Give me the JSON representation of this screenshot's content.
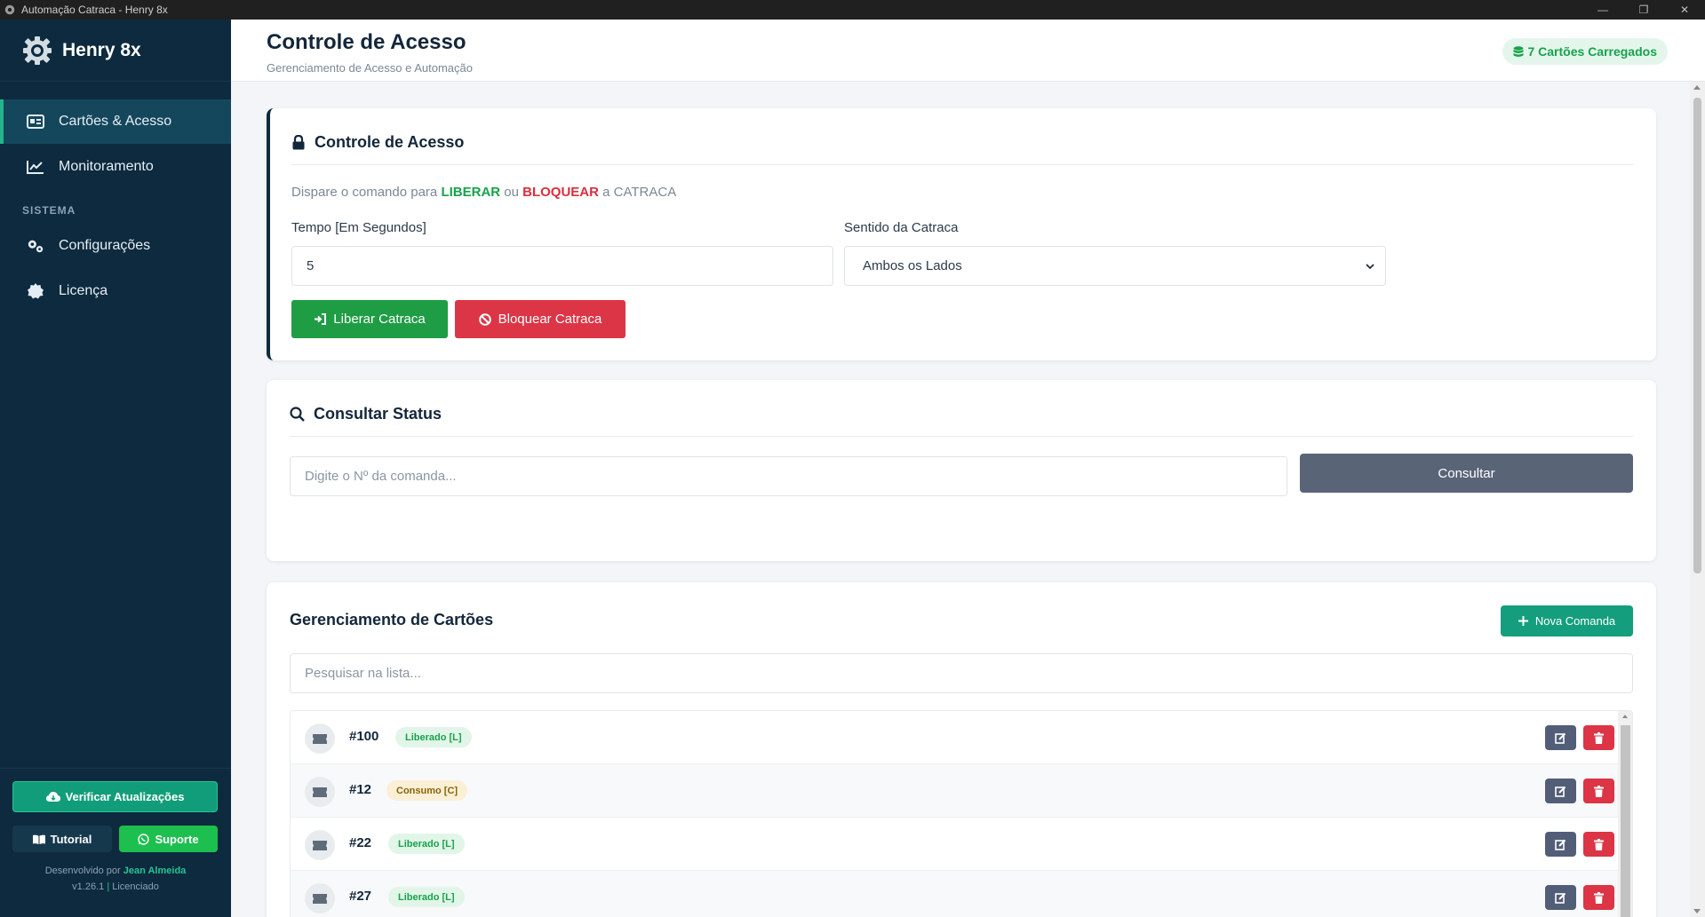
{
  "window": {
    "title": "Automação Catraca - Henry 8x",
    "minimize": "—",
    "restore": "❐",
    "close": "✕"
  },
  "brand": {
    "name": "Henry 8x"
  },
  "sidebar": {
    "items": [
      {
        "label": "Cartões & Acesso",
        "icon": "id-card-icon",
        "active": true
      },
      {
        "label": "Monitoramento",
        "icon": "chart-line-icon",
        "active": false
      }
    ],
    "section_label": "SISTEMA",
    "system_items": [
      {
        "label": "Configurações",
        "icon": "cogs-icon"
      },
      {
        "label": "Licença",
        "icon": "certificate-icon"
      }
    ],
    "update_button": "Verificar Atualizações",
    "tutorial_button": "Tutorial",
    "support_button": "Suporte",
    "credit_prefix": "Desenvolvido por",
    "credit_author": "Jean Almeida",
    "version": "v1.26.1",
    "separator": "|",
    "license_status": "Licenciado"
  },
  "header": {
    "title": "Controle de Acesso",
    "subtitle": "Gerenciamento de Acesso e Automação",
    "loaded_badge": "7 Cartões Carregados"
  },
  "access_card": {
    "title": "Controle de Acesso",
    "desc_prefix": "Dispare o comando para",
    "desc_liberar": "LIBERAR",
    "desc_ou": "ou",
    "desc_bloquear": "BLOQUEAR",
    "desc_suffix": "a CATRACA",
    "time_label": "Tempo [Em Segundos]",
    "time_value": "5",
    "direction_label": "Sentido da Catraca",
    "direction_value": "Ambos os Lados",
    "liberar_button": "Liberar Catraca",
    "bloquear_button": "Bloquear Catraca"
  },
  "status_card": {
    "title": "Consultar Status",
    "input_placeholder": "Digite o Nº da comanda...",
    "consultar_button": "Consultar"
  },
  "cards_card": {
    "title": "Gerenciamento de Cartões",
    "nova_button": "Nova Comanda",
    "search_placeholder": "Pesquisar na lista...",
    "rows": [
      {
        "id": "#100",
        "status": "Liberado [L]",
        "type": "liberado"
      },
      {
        "id": "#12",
        "status": "Consumo [C]",
        "type": "consumo"
      },
      {
        "id": "#22",
        "status": "Liberado [L]",
        "type": "liberado"
      },
      {
        "id": "#27",
        "status": "Liberado [L]",
        "type": "liberado"
      }
    ]
  },
  "colors": {
    "sidebar_bg": "#0d2a3e",
    "accent_green": "#23b68a",
    "danger_red": "#dc3545",
    "success_green": "#1f9d45",
    "neutral_button": "#5a6477"
  }
}
